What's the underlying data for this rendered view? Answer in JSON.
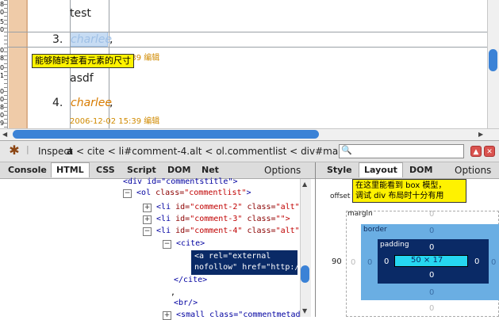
{
  "page": {
    "ruler_numbers": [
      "8",
      "0",
      "5",
      "0",
      "0",
      "8",
      "0",
      "1",
      "0",
      "0",
      "8",
      "0",
      "9",
      "0"
    ],
    "comments": [
      {
        "body": "test"
      },
      {
        "number": "3.",
        "author": "charlee",
        "comma": ",",
        "meta": "2006-12-02 10:39 编辑"
      },
      {
        "body": "asdf"
      },
      {
        "number": "4.",
        "author": "charlee",
        "comma": ",",
        "meta": "2006-12-02 15:39 编辑"
      }
    ],
    "callout_top": "能够随时查看元素的尺寸",
    "callout_right": [
      "在这里能看到 box 模型，",
      "调试 div 布局时十分有用"
    ]
  },
  "firebug": {
    "inspect_label": "Inspect",
    "breadcrumbs": [
      "a",
      "cite",
      "li#comment-4.alt",
      "ol.commentlist",
      "div#ma"
    ],
    "sep": "<",
    "search_placeholder": "",
    "tabs": [
      "Console",
      "HTML",
      "CSS",
      "Script",
      "DOM",
      "Net"
    ],
    "active_tab": "HTML",
    "options_label": "Options",
    "right_tabs": [
      "Style",
      "Layout",
      "DOM"
    ],
    "right_active": "Layout",
    "right_options": "Options"
  },
  "tree": {
    "line0": "<div id=\"commentstitle\">",
    "ol": {
      "open": "<ol",
      "attr": "class=",
      "val": "\"commentlist\"",
      "close": ">"
    },
    "li": [
      {
        "open": "<li",
        "a1": "id=",
        "v1": "\"comment-2\"",
        "a2": "class=",
        "v2": "\"alt\""
      },
      {
        "open": "<li",
        "a1": "id=",
        "v1": "\"comment-3\"",
        "a2": "class=",
        "v2": "\"\">"
      },
      {
        "open": "<li",
        "a1": "id=",
        "v1": "\"comment-4\"",
        "a2": "class=",
        "v2": "\"alt\""
      }
    ],
    "cite_open": "<cite>",
    "sel_line1": "<a rel=\"external",
    "sel_line2": "nofollow\" href=\"http:/",
    "cite_close": "</cite>",
    "comma": ",",
    "br": "<br/>",
    "small": "<small class=\"commentmetada"
  },
  "layout": {
    "offset_label": "offset",
    "margin_label": "margin",
    "border_label": "border",
    "padding_label": "padding",
    "offset_value": "90",
    "content_size": "50 × 17",
    "zero": "0"
  },
  "colors": {
    "scroll_thumb": "#3b82d6",
    "callout": "#fff200",
    "selected_node": "#0a2a66",
    "content_box": "#26d7f0",
    "border_box": "#6aaee3"
  }
}
